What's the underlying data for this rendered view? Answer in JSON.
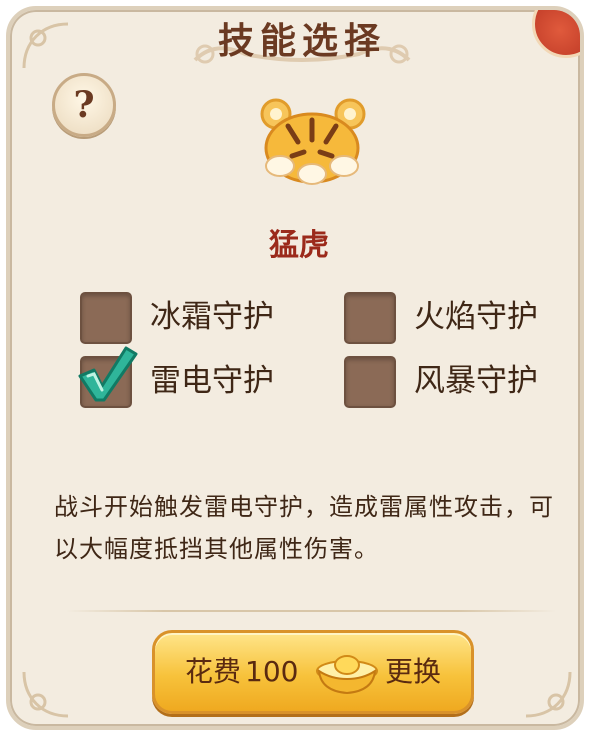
{
  "dialog": {
    "title": "技能选择",
    "help_glyph": "?",
    "pet_name": "猛虎",
    "options": [
      {
        "label": "冰霜守护",
        "checked": false
      },
      {
        "label": "火焰守护",
        "checked": false
      },
      {
        "label": "雷电守护",
        "checked": true
      },
      {
        "label": "风暴守护",
        "checked": false
      }
    ],
    "description": "战斗开始触发雷电守护，造成雷属性攻击，可以大幅度抵挡其他属性伤害。",
    "cost_button": {
      "label": "花费",
      "amount": "100",
      "action": "更换",
      "currency_icon": "gold-ingot-icon"
    }
  },
  "colors": {
    "panel_bg": "#f3ece0",
    "title_text": "#6b3a22",
    "pet_name": "#9b2a1b",
    "checkbox_fill": "#8b6a56",
    "checkmark": "#2fb59a",
    "button_gold": "#f7c23b"
  },
  "icons": {
    "help": "question-mark-icon",
    "pet": "tiger-pet-icon",
    "check": "checkmark-icon",
    "currency": "gold-ingot-icon",
    "close": "close-corner-icon"
  }
}
